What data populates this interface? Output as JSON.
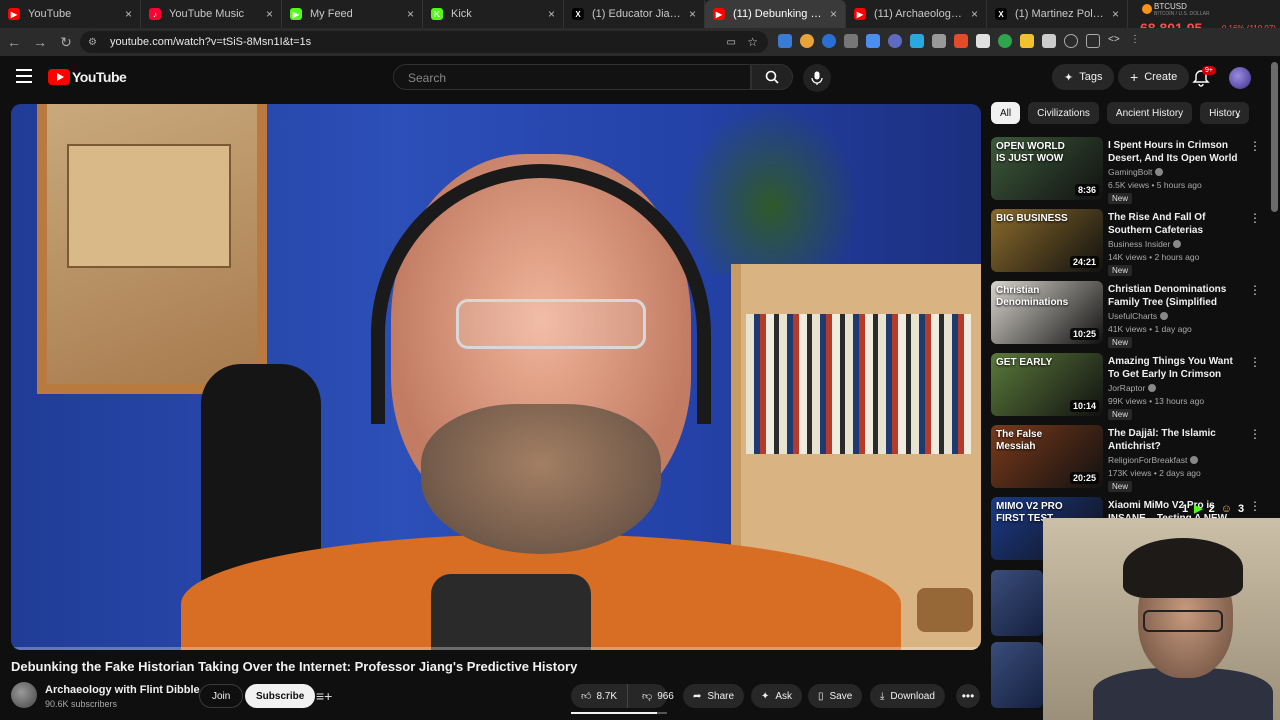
{
  "browser": {
    "tabs": [
      {
        "label": "YouTube",
        "color": "#ff0000",
        "glyph": "▶"
      },
      {
        "label": "YouTube Music",
        "color": "#ff0033",
        "glyph": "♪"
      },
      {
        "label": "My Feed",
        "color": "#53fc18",
        "glyph": "▶"
      },
      {
        "label": "Kick",
        "color": "#53fc18",
        "glyph": "K"
      },
      {
        "label": "(1) Educator Jiang Xueqin",
        "color": "#000000",
        "glyph": "X"
      },
      {
        "label": "(11) Debunking the Fa",
        "color": "#ff0000",
        "glyph": "▶"
      },
      {
        "label": "(11) Archaeology with Flin",
        "color": "#ff0000",
        "glyph": "▶"
      },
      {
        "label": "(1) Martinez Politix (@ma",
        "color": "#000000",
        "glyph": "X"
      }
    ],
    "ticker": {
      "symbol": "BTCUSD",
      "sub": "BITCOIN / U.S. DOLLAR",
      "price": "68,801.95",
      "change": "-0.16% (110.07)"
    },
    "url": "youtube.com/watch?v=tSiS-8Msn1I&t=1s"
  },
  "header": {
    "logo": "YouTube",
    "search_placeholder": "Search",
    "tags_label": "Tags",
    "create_label": "Create",
    "notif_badge": "9+"
  },
  "video": {
    "title": "Debunking the Fake Historian Taking Over the Internet: Professor Jiang's Predictive History",
    "channel": "Archaeology with Flint Dibble",
    "subscribers": "90.6K subscribers",
    "join_label": "Join",
    "subscribe_label": "Subscribe",
    "likes": "8.7K",
    "dislikes": "966",
    "share_label": "Share",
    "ask_label": "Ask",
    "save_label": "Save",
    "download_label": "Download",
    "progress_fraction": 0.002,
    "like_ratio_fraction": 0.9
  },
  "sidebar": {
    "chips": [
      "All",
      "Civilizations",
      "Ancient History",
      "History"
    ],
    "items": [
      {
        "title": "I Spent Hours in Crimson Desert, And Its Open World ...",
        "channel": "GamingBolt",
        "meta": "6.5K views • 5 hours ago",
        "badge": "New",
        "duration": "8:36",
        "thumb_text": "OPEN WORLD IS JUST WOW",
        "bg": "#3c5a3a"
      },
      {
        "title": "The Rise And Fall Of Southern Cafeterias",
        "channel": "Business Insider",
        "meta": "14K views • 2 hours ago",
        "badge": "New",
        "duration": "24:21",
        "thumb_text": "BIG BUSINESS",
        "bg": "#8a6a2a"
      },
      {
        "title": "Christian Denominations Family Tree (Simplified Version)",
        "channel": "UsefulCharts",
        "meta": "41K views • 1 day ago",
        "badge": "New",
        "duration": "10:25",
        "thumb_text": "Christian Denominations",
        "bg": "#d8d4cc"
      },
      {
        "title": "Amazing Things You Want To Get Early In Crimson Desert... ...",
        "channel": "JorRaptor",
        "meta": "99K views • 13 hours ago",
        "badge": "New",
        "duration": "10:14",
        "thumb_text": "GET EARLY",
        "bg": "#5a7a3a"
      },
      {
        "title": "The Dajjāl: The Islamic Antichrist?",
        "channel": "ReligionForBreakfast",
        "meta": "173K views • 2 days ago",
        "badge": "New",
        "duration": "20:25",
        "thumb_text": "The False Messiah",
        "bg": "#7a3a1a"
      },
      {
        "title": "Xiaomi MiMo V2 Pro is INSANE – Testing A NEW Frontier ...",
        "channel": "",
        "meta": "",
        "badge": "",
        "duration": "",
        "thumb_text": "MIMO V2 PRO FIRST TEST",
        "bg": "#1a3a8a"
      }
    ],
    "overlay": {
      "a": "1",
      "b": "2",
      "c": "3"
    }
  }
}
